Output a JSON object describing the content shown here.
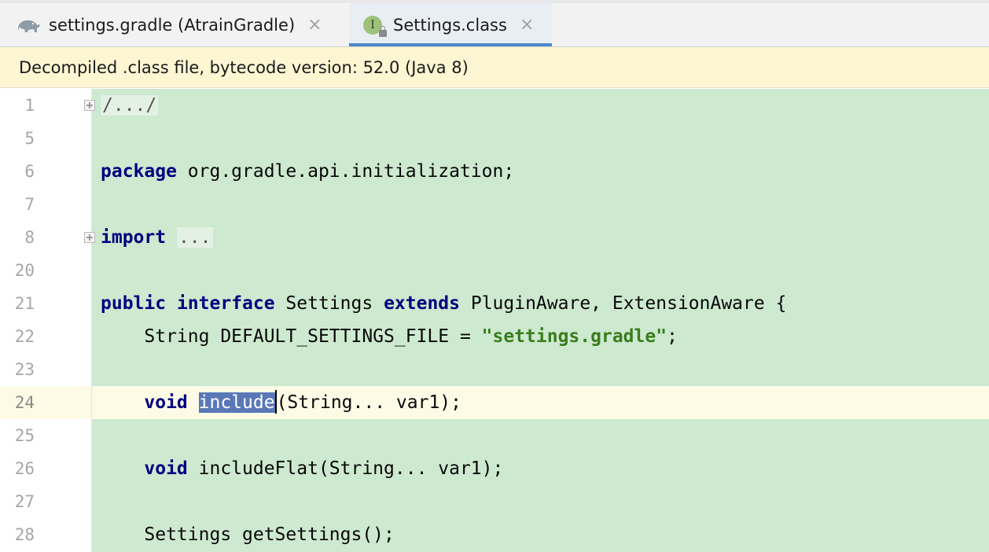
{
  "tabs": [
    {
      "label": "settings.gradle (AtrainGradle)",
      "close": "×",
      "icon": "gradle-elephant-icon"
    },
    {
      "label": "Settings.class",
      "close": "×",
      "icon": "interface-class-icon",
      "icon_letter": "I",
      "active": true
    }
  ],
  "banner": {
    "text": "Decompiled .class file, bytecode version: 52.0 (Java 8)"
  },
  "editor": {
    "current_line": "24",
    "lines": [
      {
        "n": "1",
        "text": "/.../",
        "folded": true
      },
      {
        "n": "5",
        "text": ""
      },
      {
        "n": "6",
        "kw": "package",
        "rest": " org.gradle.api.initialization;"
      },
      {
        "n": "7",
        "text": ""
      },
      {
        "n": "8",
        "kw": "import",
        "rest": " ",
        "folded_text": "...",
        "folded": true
      },
      {
        "n": "20",
        "text": ""
      },
      {
        "n": "21",
        "kw1": "public",
        "kw2": "interface",
        "mid": " Settings ",
        "kw3": "extends",
        "rest": " PluginAware, ExtensionAware {"
      },
      {
        "n": "22",
        "pre": "    String DEFAULT_SETTINGS_FILE = ",
        "str": "\"settings.gradle\"",
        "post": ";"
      },
      {
        "n": "23",
        "text": ""
      },
      {
        "n": "24",
        "indent": "    ",
        "kw": "void",
        "sp": " ",
        "sel": "include",
        "rest": "(String... var1);"
      },
      {
        "n": "25",
        "text": ""
      },
      {
        "n": "26",
        "indent": "    ",
        "kw": "void",
        "rest": " includeFlat(String... var1);"
      },
      {
        "n": "27",
        "text": ""
      },
      {
        "n": "28",
        "text": "    Settings getSettings();"
      }
    ]
  },
  "colors": {
    "code_background": "#cde9cf",
    "keyword": "#000080",
    "string": "#3a7d1d",
    "selection": "#5a78b8",
    "banner": "#fdf6d3",
    "active_tab_underline": "#4a88c7"
  }
}
